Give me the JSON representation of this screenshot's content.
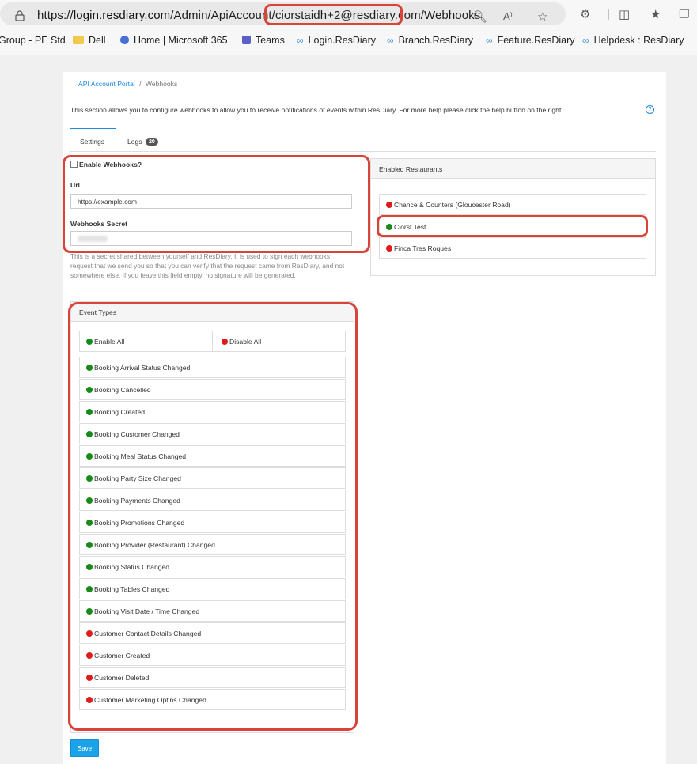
{
  "browser": {
    "url_prefix": "https://",
    "url_host": "login.resdiary.com",
    "url_path": "/Admin/ApiAccount/",
    "url_account": "ciorstaidh+2@resdiary.com",
    "url_suffix": "/Webhooks",
    "bookmarks": [
      "Group - PE Std",
      "Dell",
      "Home | Microsoft 365",
      "Teams",
      "Login.ResDiary",
      "Branch.ResDiary",
      "Feature.ResDiary",
      "Helpdesk : ResDiary"
    ]
  },
  "breadcrumb": {
    "link": "API Account Portal",
    "separator": "/",
    "current": "Webhooks"
  },
  "intro": "This section allows you to configure webhooks to allow you to receive notifications of events within ResDiary. For more help please click the help button on the right.",
  "help_icon": "?",
  "tabs": [
    {
      "label": "Settings"
    },
    {
      "label": "Logs",
      "badge": "20"
    }
  ],
  "settings": {
    "enable_label": "Enable Webhooks?",
    "url_label": "Url",
    "url_value": "https://example.com",
    "secret_label": "Webhooks Secret",
    "secret_help": "This is a secret shared between yourself and ResDiary. It is used to sign each webhooks request that we send you so that you can verify that the request came from ResDiary, and not somewhere else. If you leave this field empty, no signature will be generated."
  },
  "event_types": {
    "title": "Event Types",
    "enable_all": "Enable All",
    "disable_all": "Disable All",
    "items": [
      {
        "label": "Booking Arrival Status Changed",
        "status": "green"
      },
      {
        "label": "Booking Cancelled",
        "status": "green"
      },
      {
        "label": "Booking Created",
        "status": "green"
      },
      {
        "label": "Booking Customer Changed",
        "status": "green"
      },
      {
        "label": "Booking Meal Status Changed",
        "status": "green"
      },
      {
        "label": "Booking Party Size Changed",
        "status": "green"
      },
      {
        "label": "Booking Payments Changed",
        "status": "green"
      },
      {
        "label": "Booking Promotions Changed",
        "status": "green"
      },
      {
        "label": "Booking Provider (Restaurant) Changed",
        "status": "green"
      },
      {
        "label": "Booking Status Changed",
        "status": "green"
      },
      {
        "label": "Booking Tables Changed",
        "status": "green"
      },
      {
        "label": "Booking Visit Date / Time Changed",
        "status": "green"
      },
      {
        "label": "Customer Contact Details Changed",
        "status": "red"
      },
      {
        "label": "Customer Created",
        "status": "red"
      },
      {
        "label": "Customer Deleted",
        "status": "red"
      },
      {
        "label": "Customer Marketing Optins Changed",
        "status": "red"
      }
    ]
  },
  "restaurants": {
    "title": "Enabled Restaurants",
    "items": [
      {
        "label": "Chance & Counters (Gloucester Road)",
        "status": "red"
      },
      {
        "label": "Ciorst Test",
        "status": "green"
      },
      {
        "label": "Finca Tres Roques",
        "status": "red"
      }
    ]
  },
  "save_label": "Save",
  "colors": {
    "enabled": "#178a17",
    "disabled": "#e01b1b",
    "accent": "#1e88e5",
    "annotation": "#d9443a"
  }
}
